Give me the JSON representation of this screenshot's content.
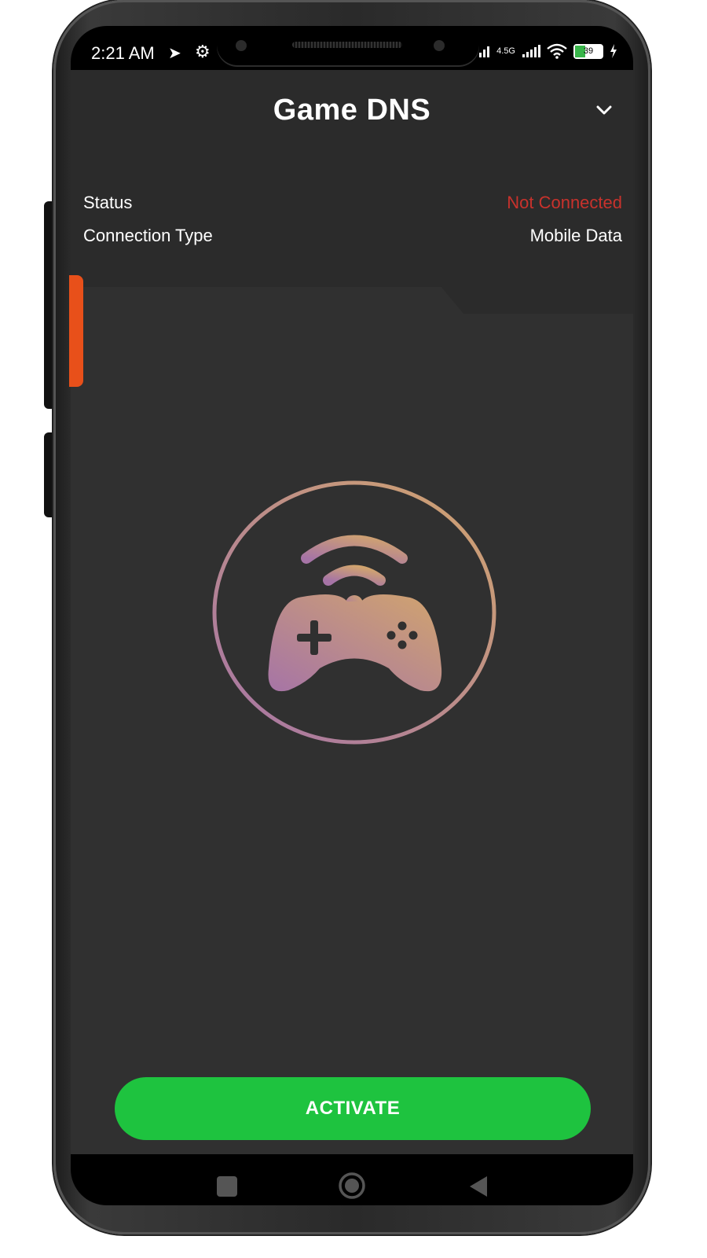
{
  "status_bar": {
    "time": "2:21 AM",
    "network_label": "4.5G",
    "battery": "39",
    "icons": [
      "telegram-icon",
      "cpu-icon",
      "signal-icon",
      "wifi-icon",
      "battery-icon",
      "charging-icon"
    ]
  },
  "header": {
    "title": "Game DNS",
    "rows": [
      {
        "label": "Status",
        "value": "Not Connected",
        "value_color": "#c8322c"
      },
      {
        "label": "Connection Type",
        "value": "Mobile Data",
        "value_color": "#ffffff"
      }
    ]
  },
  "main": {
    "activate_label": "ACTIVATE",
    "activate_color": "#1ec33f",
    "logo_icon": "game-controller-wifi-icon"
  },
  "nav_bar": {
    "icons": [
      "recents-square-icon",
      "home-circle-icon",
      "back-triangle-icon"
    ]
  },
  "colors": {
    "background": "#303030",
    "header_bg": "#2b2b2b",
    "accent_tab": "#e8501a"
  }
}
